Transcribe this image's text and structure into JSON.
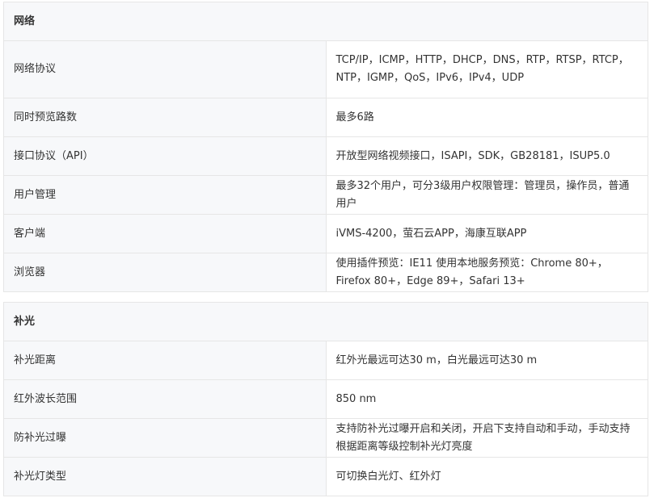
{
  "sections": [
    {
      "title": "网络",
      "rows": [
        {
          "label": "网络协议",
          "value": "TCP/IP，ICMP，HTTP，DHCP，DNS，RTP，RTSP，RTCP，NTP，IGMP，QoS，IPv6，IPv4，UDP"
        },
        {
          "label": "同时预览路数",
          "value": "最多6路"
        },
        {
          "label": "接口协议（API）",
          "value": "开放型网络视频接口，ISAPI，SDK，GB28181，ISUP5.0"
        },
        {
          "label": "用户管理",
          "value": "最多32个用户，可分3级用户权限管理：管理员，操作员，普通用户"
        },
        {
          "label": "客户端",
          "value": "iVMS-4200，萤石云APP，海康互联APP"
        },
        {
          "label": "浏览器",
          "value": "使用插件预览：IE11 使用本地服务预览：Chrome 80+，Firefox 80+，Edge 89+，Safari 13+"
        }
      ]
    },
    {
      "title": "补光",
      "rows": [
        {
          "label": "补光距离",
          "value": "红外光最远可达30 m，白光最远可达30 m"
        },
        {
          "label": "红外波长范围",
          "value": "850 nm"
        },
        {
          "label": "防补光过曝",
          "value": "支持防补光过曝开启和关闭，开启下支持自动和手动，手动支持根据距离等级控制补光灯亮度"
        },
        {
          "label": "补光灯类型",
          "value": "可切换白光灯、红外灯"
        }
      ]
    }
  ]
}
